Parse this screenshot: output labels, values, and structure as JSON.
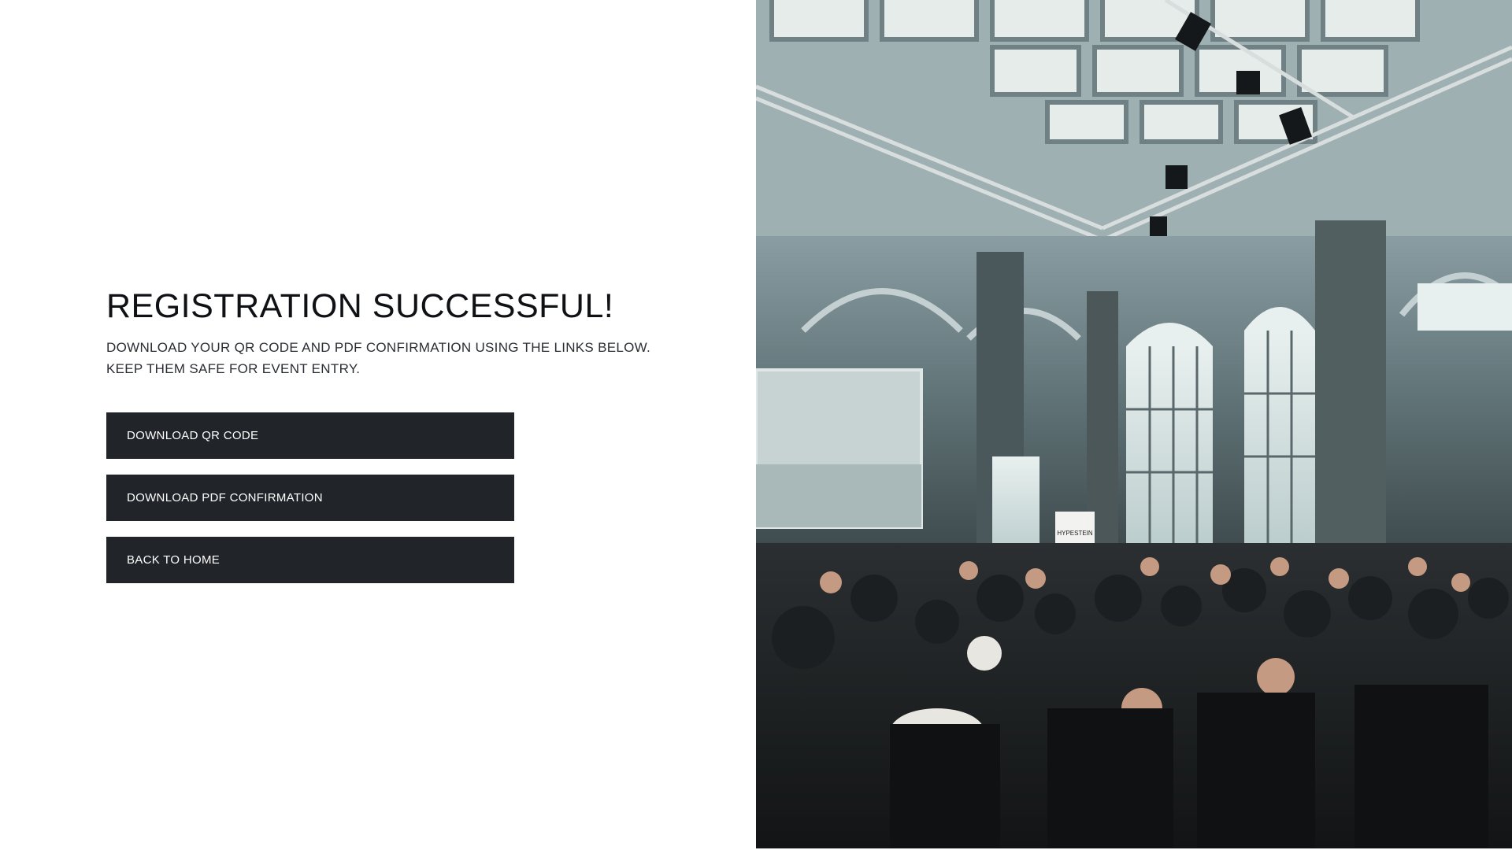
{
  "main": {
    "title": "REGISTRATION SUCCESSFUL!",
    "message_line1": "DOWNLOAD YOUR QR CODE AND PDF CONFIRMATION USING THE LINKS BELOW.",
    "message_line2": "KEEP THEM SAFE FOR EVENT ENTRY.",
    "buttons": [
      {
        "label": "DOWNLOAD QR CODE"
      },
      {
        "label": "DOWNLOAD PDF CONFIRMATION"
      },
      {
        "label": "BACK TO HOME"
      }
    ]
  },
  "hero": {
    "banner_text": "HYPESTEIN"
  },
  "colors": {
    "button_bg": "#212428",
    "button_text": "#ffffff",
    "title_text": "#0f1115"
  }
}
